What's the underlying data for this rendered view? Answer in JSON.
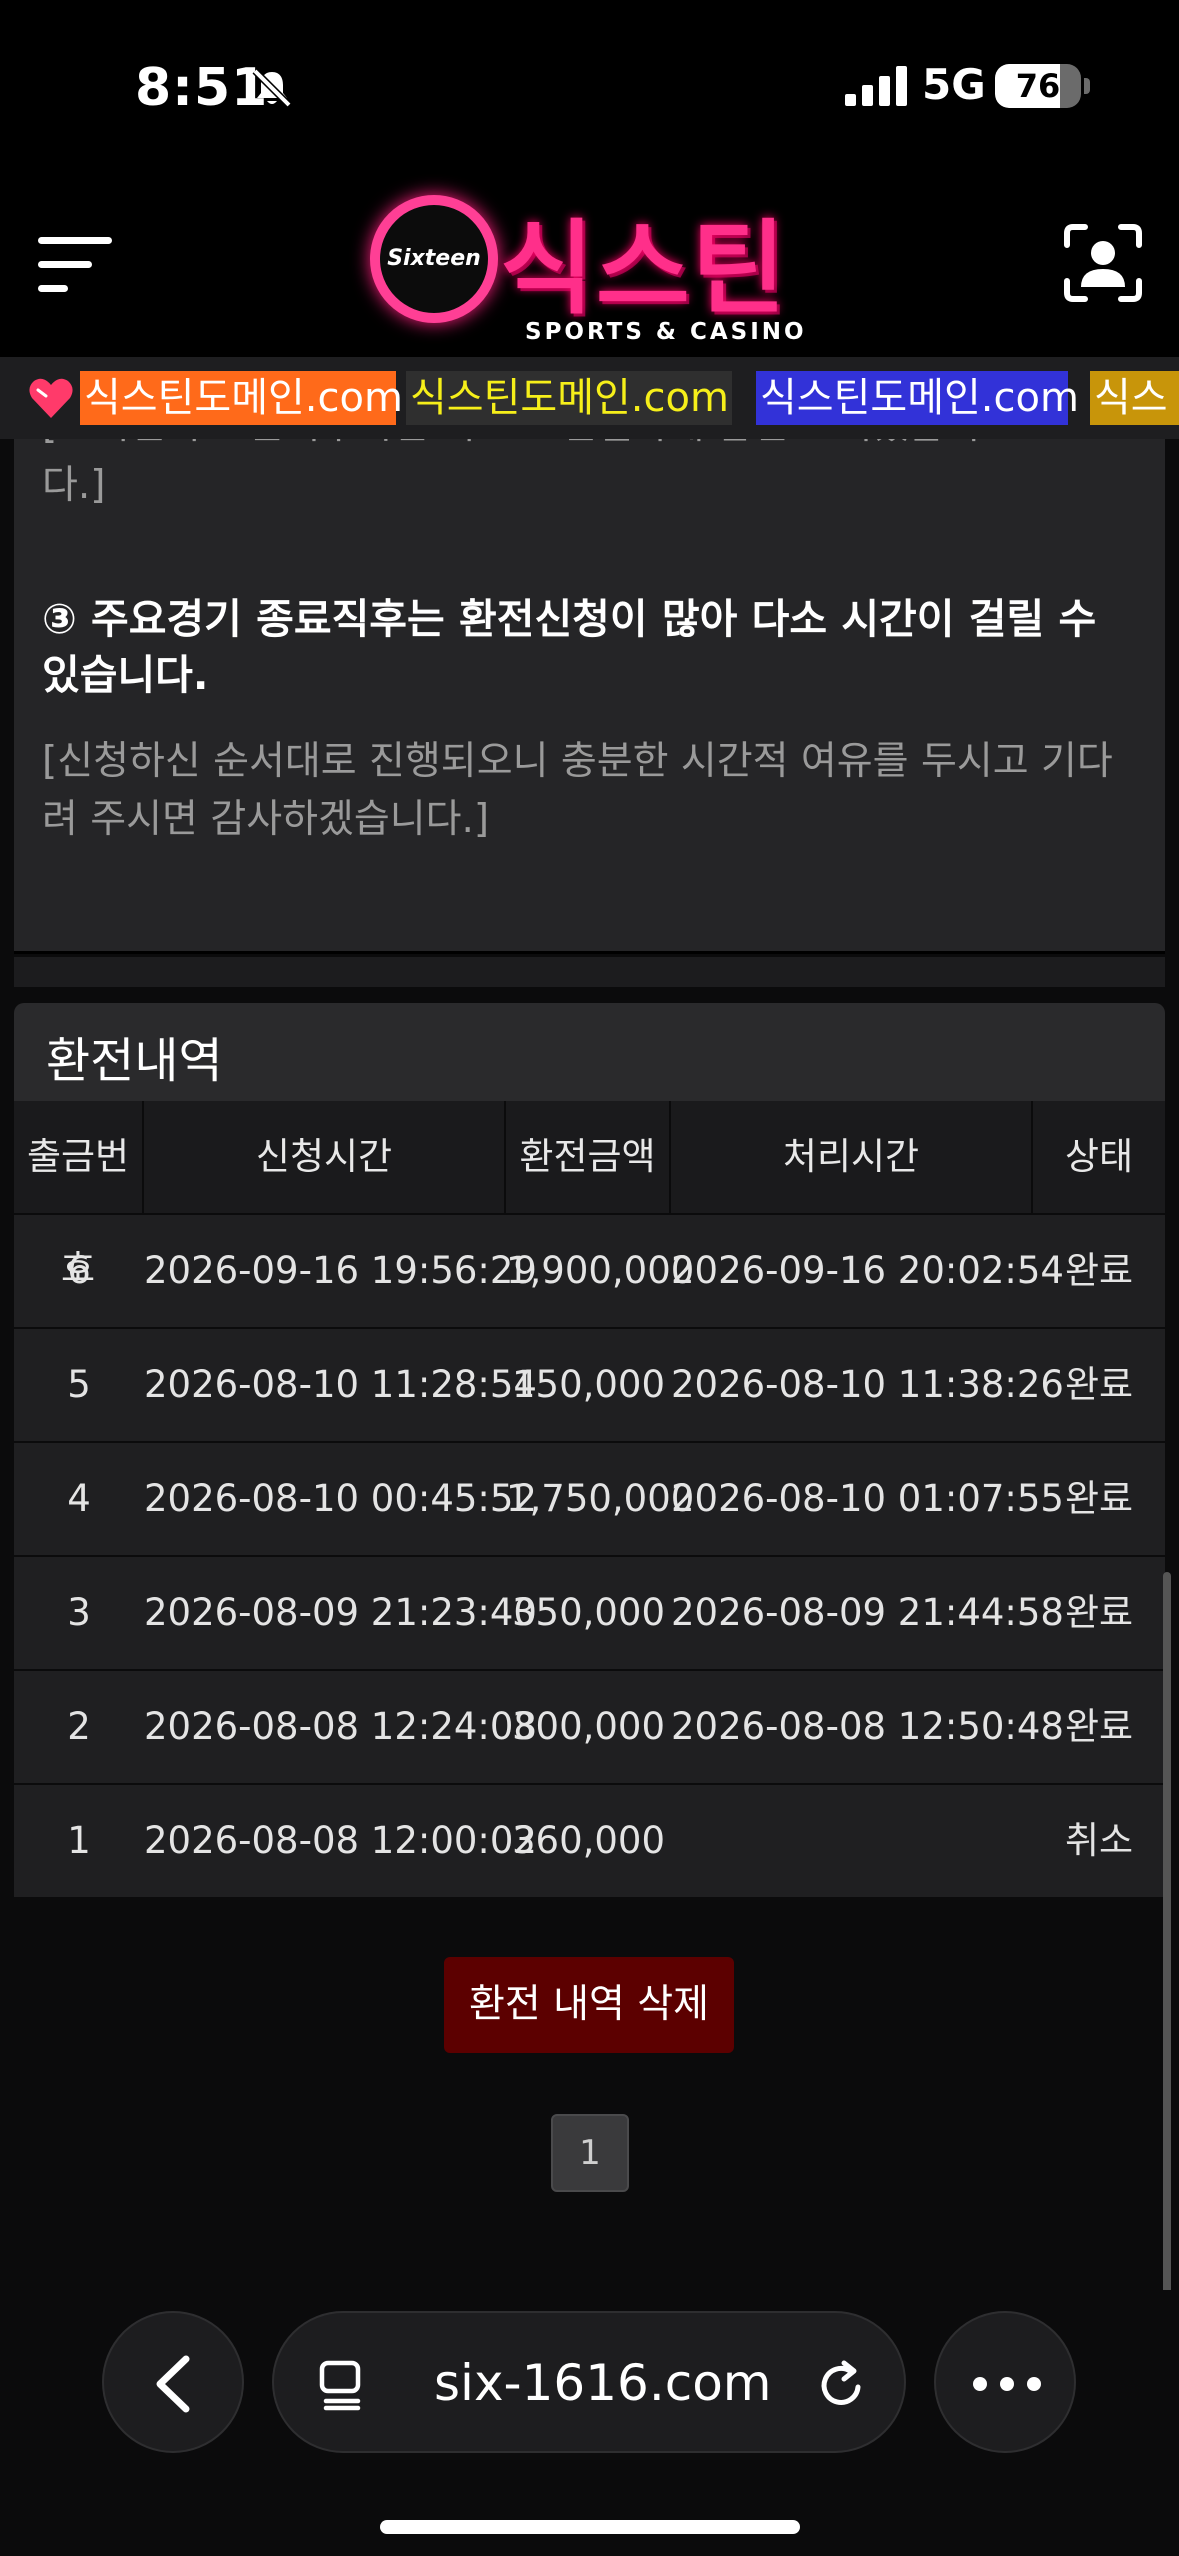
{
  "status_bar": {
    "time": "8:51",
    "network": "5G",
    "battery": "76",
    "battery_level": 0.76
  },
  "header": {
    "logo_ring_text": "Sixteen",
    "logo_main": "식스틴",
    "logo_sub": "SPORTS & CASINO"
  },
  "marquee": {
    "items": [
      "식스틴도메인.com",
      "식스틴도메인.com",
      "식스틴도메인.com",
      "식스"
    ],
    "colors": [
      "#ff6a1a",
      "#2f2f2f",
      "#3232d8",
      "#c8950a"
    ]
  },
  "notice": {
    "cut_line": "[고객센터로 문의주시면 빠르고 친절하게 답변 드리겠습니",
    "cut_end": "다.]",
    "heading": "③ 주요경기 종료직후는 환전신청이 많아 다소 시간이 걸릴 수 있습니다.",
    "body": "[신청하신 순서대로 진행되오니 충분한 시간적 여유를 두시고 기다려 주시면 감사하겠습니다.]"
  },
  "history": {
    "title": "환전내역",
    "columns": [
      "출금번호",
      "신청시간",
      "환전금액",
      "처리시간",
      "상태"
    ],
    "rows": [
      [
        "6",
        "2026-09-16 19:56:29",
        "1,900,000",
        "2026-09-16 20:02:54",
        "완료"
      ],
      [
        "5",
        "2026-08-10 11:28:54",
        "150,000",
        "2026-08-10 11:38:26",
        "완료"
      ],
      [
        "4",
        "2026-08-10 00:45:52",
        "1,750,000",
        "2026-08-10 01:07:55",
        "완료"
      ],
      [
        "3",
        "2026-08-09 21:23:40",
        "350,000",
        "2026-08-09 21:44:58",
        "완료"
      ],
      [
        "2",
        "2026-08-08 12:24:08",
        "300,000",
        "2026-08-08 12:50:48",
        "완료"
      ],
      [
        "1",
        "2026-08-08 12:00:02",
        "360,000",
        "",
        "취소"
      ]
    ],
    "delete_label": "환전 내역 삭제",
    "page": "1"
  },
  "browser": {
    "url": "six-1616.com"
  },
  "colors": {
    "accent_pink": "#ff2f8a",
    "delete_red": "#5c0000"
  }
}
